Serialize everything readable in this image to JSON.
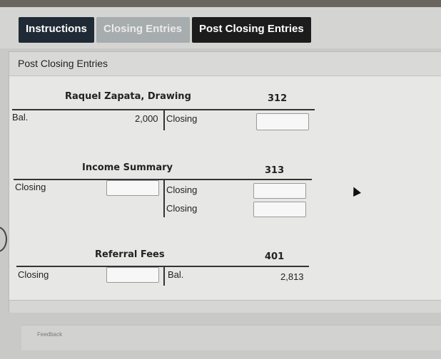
{
  "tabs": {
    "instructions": "Instructions",
    "closing_entries": "Closing Entries",
    "post_closing_entries": "Post Closing Entries"
  },
  "panel": {
    "title": "Post Closing Entries"
  },
  "accounts": [
    {
      "name": "Raquel Zapata, Drawing",
      "number": "312",
      "debit": [
        {
          "label": "Bal.",
          "value": "2,000"
        }
      ],
      "credit": [
        {
          "label": "Closing",
          "value": ""
        }
      ]
    },
    {
      "name": "Income Summary",
      "number": "313",
      "debit": [
        {
          "label": "Closing",
          "value": ""
        }
      ],
      "credit": [
        {
          "label": "Closing",
          "value": ""
        },
        {
          "label": "Closing",
          "value": ""
        }
      ]
    },
    {
      "name": "Referral Fees",
      "number": "401",
      "debit": [
        {
          "label": "Closing",
          "value": ""
        }
      ],
      "credit": [
        {
          "label": "Bal.",
          "value": "2,813"
        }
      ]
    }
  ],
  "feedback": {
    "label": "Feedback"
  }
}
